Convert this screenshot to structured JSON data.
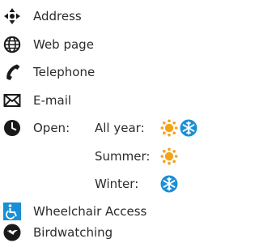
{
  "legend": {
    "address": {
      "label": "Address",
      "icon": "four-arrows-direction-icon"
    },
    "web_page": {
      "label": "Web page",
      "icon": "globe-icon"
    },
    "telephone": {
      "label": "Telephone",
      "icon": "phone-handset-icon"
    },
    "email": {
      "label": "E-mail",
      "icon": "envelope-icon"
    },
    "open": {
      "label": "Open:",
      "icon": "clock-icon",
      "all_year": {
        "label": "All year:",
        "icons": [
          "sun-icon",
          "snowflake-icon"
        ]
      },
      "summer": {
        "label": "Summer:",
        "icons": [
          "sun-icon"
        ]
      },
      "winter": {
        "label": "Winter:",
        "icons": [
          "snowflake-icon"
        ]
      }
    },
    "wheelchair": {
      "label": "Wheelchair Access",
      "icon": "wheelchair-icon"
    },
    "birdwatching": {
      "label": "Birdwatching",
      "icon": "bird-icon"
    }
  },
  "colors": {
    "icon_dark": "#1a1a1a",
    "sun": "#f5a21b",
    "snow": "#1b8fd6",
    "wheelchair": "#1b8fd6"
  }
}
